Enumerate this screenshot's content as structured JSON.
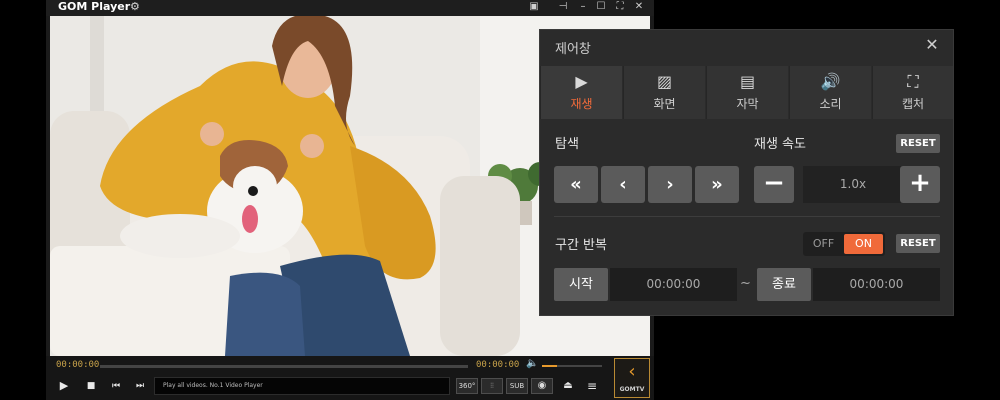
{
  "player": {
    "logo": "GOM Player",
    "current_time": "00:00:00",
    "total_time": "00:00:00",
    "marquee_text": "Play all videos. No.1 Video Player",
    "btn_360": "360°",
    "btn_sub": "SUB",
    "gomtv_label": "GOMTV",
    "volume_level": 0.25,
    "progress": 0.0,
    "accent_color": "#e79a2d"
  },
  "panel": {
    "title": "제어창",
    "tabs": [
      {
        "label": "재생",
        "icon": "play-icon",
        "active": true
      },
      {
        "label": "화면",
        "icon": "image-icon",
        "active": false
      },
      {
        "label": "자막",
        "icon": "subtitle-icon",
        "active": false
      },
      {
        "label": "소리",
        "icon": "speaker-icon",
        "active": false
      },
      {
        "label": "캡처",
        "icon": "capture-icon",
        "active": false
      }
    ],
    "seek_label": "탐색",
    "speed_label": "재생 속도",
    "speed_value": "1.0x",
    "reset_label": "RESET",
    "repeat_label": "구간 반복",
    "toggle_off": "OFF",
    "toggle_on": "ON",
    "start_label": "시작",
    "start_time": "00:00:00",
    "range_sep": "~",
    "end_label": "종료",
    "end_time": "00:00:00",
    "active_color": "#f06a3a"
  }
}
